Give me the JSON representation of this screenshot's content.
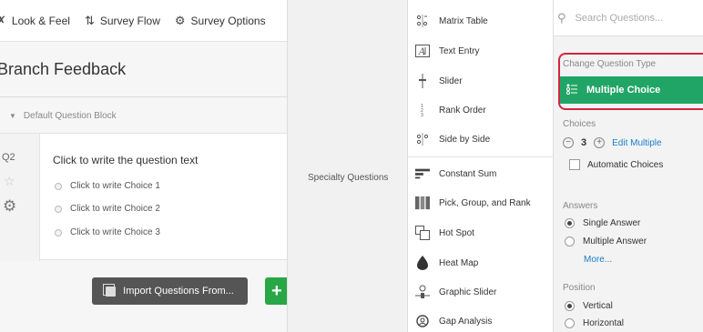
{
  "toolbar": {
    "items": [
      {
        "label": "Look & Feel",
        "icon": "brush-icon"
      },
      {
        "label": "Survey Flow",
        "icon": "flow-icon"
      },
      {
        "label": "Survey Options",
        "icon": "gear-icon"
      }
    ]
  },
  "editor": {
    "survey_title": "Branch Feedback",
    "block_name": "Default Question Block",
    "question": {
      "number": "Q2",
      "text": "Click to write the question text",
      "choices": [
        "Click to write Choice 1",
        "Click to write Choice 2",
        "Click to write Choice 3"
      ]
    },
    "import_label": "Import Questions From...",
    "add_label": "+"
  },
  "question_type_menu": {
    "category": "Specialty Questions",
    "items": [
      {
        "label": "Matrix Table",
        "icon": "matrix-icon"
      },
      {
        "label": "Text Entry",
        "icon": "text-entry-icon"
      },
      {
        "label": "Slider",
        "icon": "slider-icon"
      },
      {
        "label": "Rank Order",
        "icon": "rank-order-icon"
      },
      {
        "label": "Side by Side",
        "icon": "side-by-side-icon"
      },
      {
        "label": "Constant Sum",
        "icon": "constant-sum-icon"
      },
      {
        "label": "Pick, Group, and Rank",
        "icon": "pick-group-rank-icon"
      },
      {
        "label": "Hot Spot",
        "icon": "hot-spot-icon"
      },
      {
        "label": "Heat Map",
        "icon": "heat-map-icon"
      },
      {
        "label": "Graphic Slider",
        "icon": "graphic-slider-icon"
      },
      {
        "label": "Gap Analysis",
        "icon": "gap-analysis-icon"
      }
    ]
  },
  "panel": {
    "search_placeholder": "Search Questions...",
    "change_type_label": "Change Question Type",
    "current_type": "Multiple Choice",
    "choices_label": "Choices",
    "choices_count": "3",
    "edit_multiple": "Edit Multiple",
    "automatic_choices": "Automatic Choices",
    "answers_label": "Answers",
    "answers": [
      {
        "label": "Single Answer",
        "selected": true
      },
      {
        "label": "Multiple Answer",
        "selected": false
      }
    ],
    "more_label": "More...",
    "position_label": "Position",
    "positions": [
      {
        "label": "Vertical",
        "selected": true
      },
      {
        "label": "Horizontal",
        "selected": false
      }
    ]
  },
  "colors": {
    "accent_green": "#21a566",
    "highlight_red": "#d0273e",
    "link_blue": "#1a7ec9"
  }
}
